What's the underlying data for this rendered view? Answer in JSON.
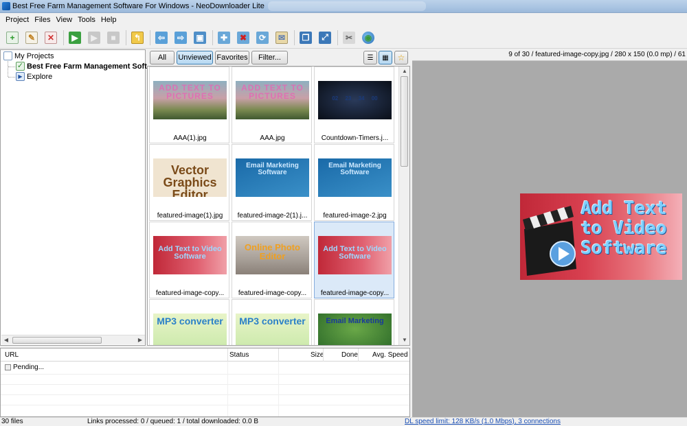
{
  "window": {
    "title": "Best Free Farm Management Software For Windows - NeoDownloader Lite"
  },
  "menu": [
    "Project",
    "Files",
    "View",
    "Tools",
    "Help"
  ],
  "toolbar": {
    "buttons": [
      "new-project-icon",
      "edit-project-icon",
      "delete-project-icon",
      "start-icon",
      "pause-icon",
      "stop-icon",
      "open-folder-icon",
      "import-icon",
      "export-icon",
      "show-icon",
      "add-url-icon",
      "remove-url-icon",
      "refresh-icon",
      "mail-icon",
      "window-icon",
      "fullscreen-icon",
      "tools-icon",
      "globe-icon"
    ]
  },
  "tree": {
    "root": "My Projects",
    "project": "Best Free Farm Management Software For Windows",
    "explore": "Explore"
  },
  "filters": {
    "all": "All",
    "unviewed": "Unviewed",
    "favorites": "Favorites",
    "filter": "Filter..."
  },
  "files": [
    {
      "name": "AAA(1).jpg",
      "text": "ADD TEXT TO PICTURES"
    },
    {
      "name": "AAA.jpg",
      "text": "ADD TEXT TO PICTURES"
    },
    {
      "name": "Countdown-Timers.j...",
      "text": "02 23 34 00"
    },
    {
      "name": "featured-image(1).jpg",
      "text": "Vector Graphics Editor"
    },
    {
      "name": "featured-image-2(1).j...",
      "text": "Email Marketing Software"
    },
    {
      "name": "featured-image-2.jpg",
      "text": "Email Marketing Software"
    },
    {
      "name": "featured-image-copy...",
      "text": "Add Text to Video Software"
    },
    {
      "name": "featured-image-copy...",
      "text": "Online Photo Editor"
    },
    {
      "name": "featured-image-copy...",
      "text": "Add Text to Video Software"
    },
    {
      "name": "",
      "text": "MP3 converter"
    },
    {
      "name": "",
      "text": "MP3 converter"
    },
    {
      "name": "",
      "text": "Email Marketing"
    }
  ],
  "preview": {
    "info": "9 of 30 / featured-image-copy.jpg / 280 x 150 (0.0 mp) / 61",
    "image_text_1": "Add Text",
    "image_text_2": "to Video",
    "image_text_3": "Software"
  },
  "downloads": {
    "columns": {
      "url": "URL",
      "status": "Status",
      "size": "Size",
      "done": "Done",
      "speed": "Avg. Speed"
    },
    "rows": [
      {
        "url": "Pending..."
      }
    ]
  },
  "status": {
    "files": "30 files",
    "links": "Links processed: 0 / queued: 1 / total downloaded: 0.0 B",
    "speed": "DL speed limit: 128 KB/s (1.0 Mbps), 3 connections"
  }
}
